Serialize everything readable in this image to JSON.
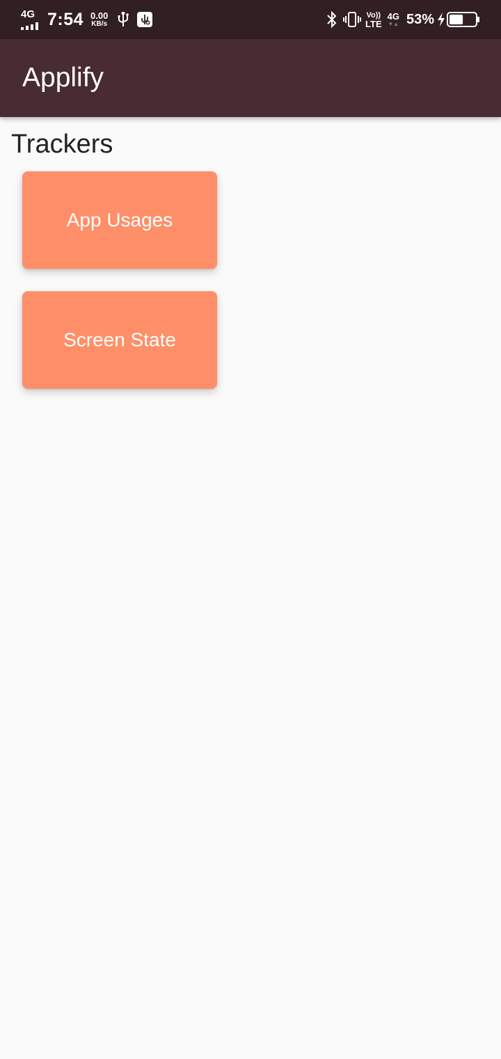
{
  "status_bar": {
    "network_type": "4G",
    "time": "7:54",
    "data_speed_value": "0.00",
    "data_speed_unit": "KB/s",
    "volte_top": "Vo))",
    "volte_bottom": "LTE",
    "network_type_2": "4G",
    "battery_percent": "53%",
    "battery_level": 0.53,
    "icons": [
      "signal-icon",
      "usb-icon",
      "usb-debug-icon",
      "bluetooth-icon",
      "vibrate-icon",
      "charging-icon",
      "battery-icon"
    ]
  },
  "app_bar": {
    "title": "Applify",
    "background": "#482C31"
  },
  "main": {
    "section_title": "Trackers",
    "cards": [
      {
        "label": "App Usages"
      },
      {
        "label": "Screen State"
      }
    ],
    "card_color": "#FF8F68"
  },
  "colors": {
    "status_bar": "#321F23",
    "page_background": "#FAFAFA"
  }
}
